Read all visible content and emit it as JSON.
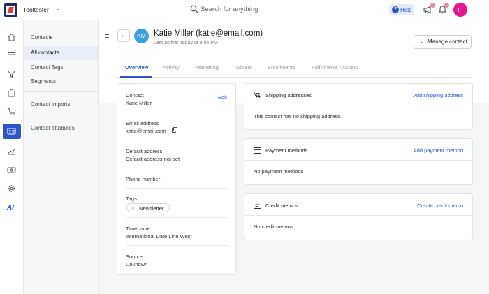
{
  "app": {
    "brand": "Tooltester"
  },
  "search": {
    "placeholder": "Search for anything"
  },
  "topbar": {
    "help_label": "Help",
    "avatar_initials": "TT"
  },
  "rail": {
    "ai_label": "AI"
  },
  "subnav": {
    "items": [
      {
        "label": "Contacts"
      },
      {
        "label": "All contacts"
      },
      {
        "label": "Contact Tags"
      },
      {
        "label": "Segments"
      },
      {
        "label": "Contact Imports"
      },
      {
        "label": "Contact attributes"
      }
    ]
  },
  "header": {
    "avatar_initials": "KM",
    "name": "Katie Miller (katie@email.com)",
    "last_active": "Last active: Today at 8:06 PM",
    "manage_button": "Manage contact"
  },
  "tabs": [
    {
      "label": "Overview"
    },
    {
      "label": "Activity"
    },
    {
      "label": "Marketing"
    },
    {
      "label": "Orders"
    },
    {
      "label": "Enrollments"
    },
    {
      "label": "Fulfillments / Assets"
    }
  ],
  "details": {
    "edit_label": "Edit",
    "contact_label": "Contact",
    "contact_value": "Katie Miller",
    "email_label": "Email address",
    "email_value": "katie@email.com",
    "address_label": "Default address",
    "address_value": "Default address not set",
    "phone_label": "Phone number",
    "tags_label": "Tags",
    "tag_value": "Newsletter",
    "timezone_label": "Time zone",
    "timezone_value": "International Date Line West",
    "source_label": "Source",
    "source_value": "Unknown"
  },
  "shipping": {
    "title": "Shipping addresses",
    "action": "Add shipping address",
    "body": "This contact has no shipping address."
  },
  "payment": {
    "title": "Payment methods",
    "action": "Add payment method",
    "body": "No payment methods"
  },
  "credit": {
    "title": "Credit memos",
    "action": "Create credit memo",
    "body": "No credit memos"
  },
  "colors": {
    "accent": "#2b56c5",
    "avatar_tt": "#e6178e",
    "avatar_km": "#3aa1de"
  }
}
